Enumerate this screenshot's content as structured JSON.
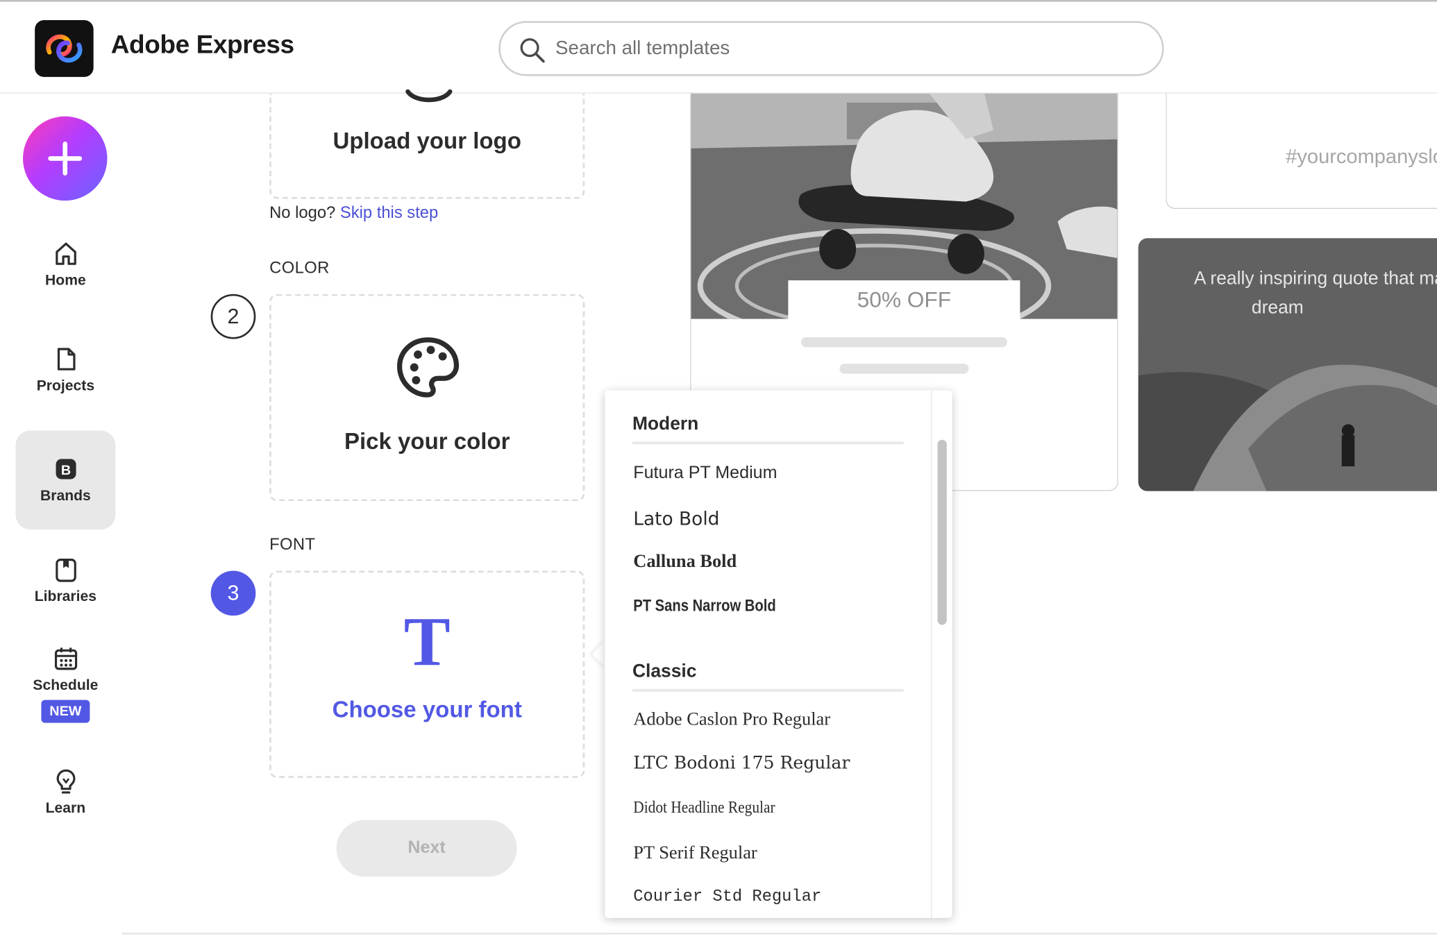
{
  "header": {
    "app_name": "Adobe Express",
    "search_placeholder": "Search all templates"
  },
  "sidebar": {
    "create_label": "+",
    "items": [
      {
        "label": "Home",
        "icon": "home-icon"
      },
      {
        "label": "Projects",
        "icon": "document-icon"
      },
      {
        "label": "Brands",
        "icon": "brand-icon",
        "active": true
      },
      {
        "label": "Libraries",
        "icon": "library-icon"
      },
      {
        "label": "Schedule",
        "icon": "calendar-icon",
        "badge": "NEW"
      },
      {
        "label": "Learn",
        "icon": "lightbulb-icon"
      }
    ]
  },
  "setup": {
    "logo": {
      "title": "Upload your logo",
      "no_logo": "No logo?",
      "skip": "Skip this step"
    },
    "color": {
      "section": "COLOR",
      "step": "2",
      "title": "Pick your color"
    },
    "font": {
      "section": "FONT",
      "step": "3",
      "title": "Choose your font",
      "icon_letter": "T"
    },
    "next_label": "Next"
  },
  "preview": {
    "promo_text": "50% OFF",
    "hashtag": "#yourcompanyslogan",
    "quote_line1": "A really inspiring quote that makes you",
    "quote_line2": "dream"
  },
  "font_dropdown": {
    "groups": [
      {
        "name": "Modern",
        "fonts": [
          "Futura PT Medium",
          "Lato Bold",
          "Calluna Bold",
          "PT Sans Narrow Bold"
        ]
      },
      {
        "name": "Classic",
        "fonts": [
          "Adobe Caslon Pro Regular",
          "LTC Bodoni 175 Regular",
          "Didot Headline Regular",
          "PT Serif Regular",
          "Courier Std Regular"
        ]
      }
    ]
  },
  "colors": {
    "accent": "#5258e4",
    "link": "#4b4fd6",
    "create_gradient": [
      "#ff3ab8",
      "#b33dff",
      "#6a63ff"
    ]
  }
}
